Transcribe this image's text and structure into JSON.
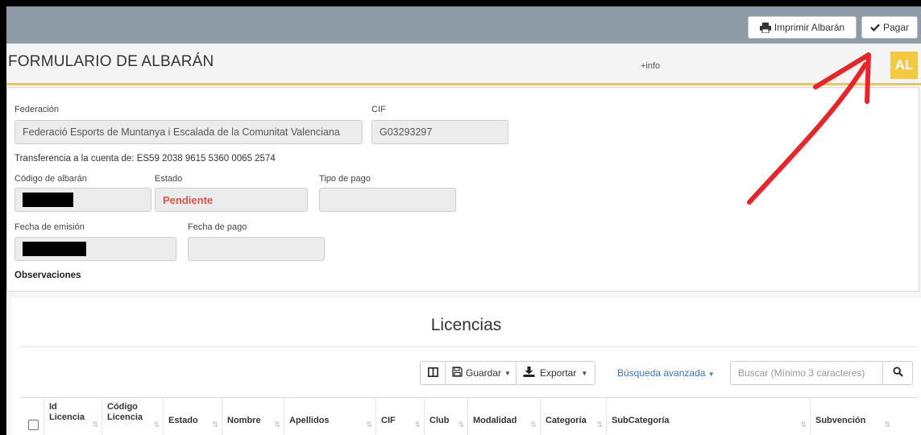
{
  "topbar": {
    "print_label": "Imprimir Albarán",
    "pay_label": "Pagar"
  },
  "header": {
    "title": "FORMULARIO DE ALBARÁN",
    "more_info": "+info",
    "badge": "AL",
    "accent_color": "#f5c842"
  },
  "form": {
    "federacion_label": "Federación",
    "federacion_value": "Federació Esports de Muntanya i Escalada de la Comunitat Valenciana",
    "cif_label": "CIF",
    "cif_value": "G03293297",
    "transfer_text": "Transferencia a la cuenta de: ES59 2038 9615 5360 0065 2574",
    "codigo_label": "Código de albarán",
    "estado_label": "Estado",
    "estado_value": "Pendiente",
    "estado_color": "#e0524a",
    "tipo_pago_label": "Tipo de pago",
    "tipo_pago_value": "",
    "fecha_emision_label": "Fecha de emisión",
    "fecha_pago_label": "Fecha de pago",
    "fecha_pago_value": "",
    "observaciones_label": "Observaciones"
  },
  "licencias": {
    "title": "Licencias",
    "guardar_label": "Guardar",
    "exportar_label": "Exportar",
    "advanced_search_label": "Búsqueda avanzada",
    "search_placeholder": "Buscar (Mínimo 3 caracteres)",
    "columns": [
      {
        "line1": "Id",
        "line2": "Licencia"
      },
      {
        "line1": "Código",
        "line2": "Licencia"
      },
      {
        "line1": "Estado",
        "line2": ""
      },
      {
        "line1": "Nombre",
        "line2": ""
      },
      {
        "line1": "Apellidos",
        "line2": ""
      },
      {
        "line1": "CIF",
        "line2": ""
      },
      {
        "line1": "Club",
        "line2": ""
      },
      {
        "line1": "Modalidad",
        "line2": ""
      },
      {
        "line1": "Categoría",
        "line2": ""
      },
      {
        "line1": "SubCategoría",
        "line2": ""
      },
      {
        "line1": "Subvención",
        "line2": ""
      }
    ],
    "link_color": "#3a78c3"
  },
  "annotation": {
    "arrow_color": "#e8262a"
  }
}
